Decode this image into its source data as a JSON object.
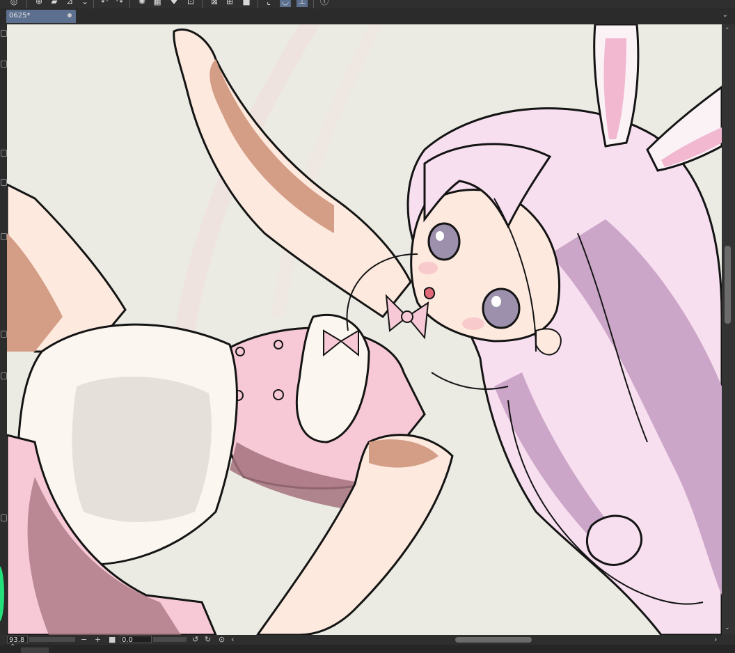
{
  "document": {
    "tab_name": "0625*",
    "tab_menu_icon": "chevron-down-icon"
  },
  "statusbar": {
    "zoom": "93.8",
    "zoom_minus": "−",
    "zoom_plus": "+",
    "rotation": "0.0",
    "scroll_left": "‹",
    "scroll_right": "›"
  },
  "colors": {
    "tab_active": "#5d6f8f",
    "canvas_bg": "#ebebe4",
    "hair": "#f8dff0",
    "hair_shadow": "#cca6c8",
    "skin": "#fde9de",
    "skin_shadow": "#d49d86",
    "dress": "#f7c9d6",
    "dress_shadow": "#a4727e",
    "apron": "#fbf6ef",
    "eye": "#9c90ac",
    "ear_inner": "#f2b8d0",
    "line": "#141414"
  }
}
